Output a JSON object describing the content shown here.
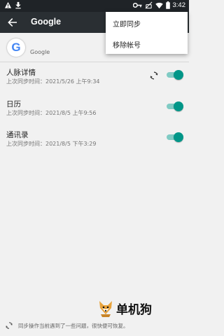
{
  "status_bar": {
    "time": "3:42",
    "icons": [
      "alert-icon",
      "download-icon",
      "vpn-key-icon",
      "wifi-icon",
      "battery-icon"
    ]
  },
  "app_bar": {
    "title": "Google",
    "back_icon": "arrow-back-icon"
  },
  "account": {
    "logo_letter": "G",
    "label": "Google"
  },
  "menu": {
    "items": [
      {
        "label": "立即同步"
      },
      {
        "label": "移除帐号"
      }
    ]
  },
  "sync_items": [
    {
      "title": "人脉详情",
      "subtitle": "上次同步时间：2021/5/26 上午9:34",
      "syncing": true,
      "enabled": true
    },
    {
      "title": "日历",
      "subtitle": "上次同步时间：2021/8/5 上午9:56",
      "syncing": false,
      "enabled": true
    },
    {
      "title": "通讯录",
      "subtitle": "上次同步时间：2021/8/5 下午3:29",
      "syncing": false,
      "enabled": true
    }
  ],
  "footer": {
    "text": "同步操作当前遇到了一些问题，很快便可恢复。"
  },
  "watermark": {
    "text": "单机狗"
  },
  "colors": {
    "toolbar": "#2a2f33",
    "status_bar": "#1f2327",
    "accent": "#009688",
    "accent_track": "#80cbc4",
    "background": "#f1f1f1"
  }
}
